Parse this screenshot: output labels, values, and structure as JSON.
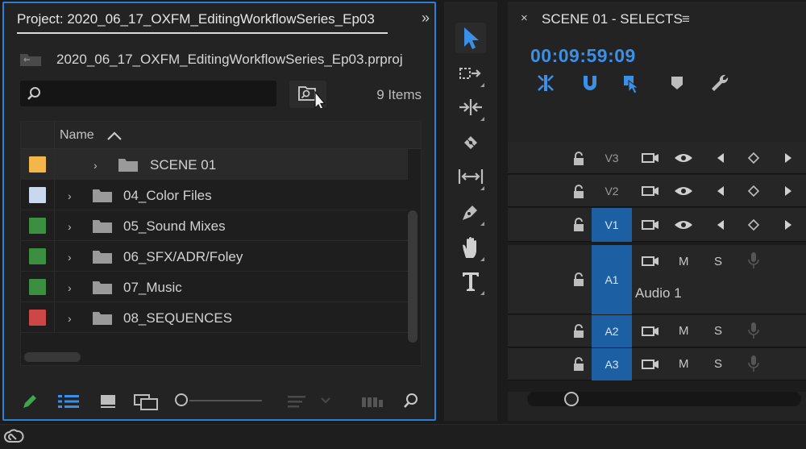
{
  "project_panel": {
    "tab_title": "Project: 2020_06_17_OXFM_EditingWorkflowSeries_Ep03",
    "menu_glyph": "»",
    "project_file": "2020_06_17_OXFM_EditingWorkflowSeries_Ep03.prproj",
    "search": {
      "placeholder": "",
      "value": ""
    },
    "item_count": "9 Items",
    "column_name": "Name",
    "items": [
      {
        "name": "SCENE 01",
        "color": "#f2b64a",
        "nested": true
      },
      {
        "name": "04_Color Files",
        "color": "#c9d8ef",
        "nested": false
      },
      {
        "name": "05_Sound Mixes",
        "color": "#3c8f41",
        "nested": false
      },
      {
        "name": "06_SFX/ADR/Foley",
        "color": "#3c8f41",
        "nested": false
      },
      {
        "name": "07_Music",
        "color": "#3c8f41",
        "nested": false
      },
      {
        "name": "08_SEQUENCES",
        "color": "#cc4745",
        "nested": false
      }
    ]
  },
  "timeline_panel": {
    "close_glyph": "×",
    "sequence_title": "SCENE 01 - SELECTS",
    "menu_glyph": "≡",
    "timecode": "00:09:59:09",
    "accent": "#3b8fe6",
    "video_tracks": [
      "V3",
      "V2",
      "V1"
    ],
    "audio_tracks": [
      "A1",
      "A2",
      "A3"
    ],
    "mute_label": "M",
    "solo_label": "S",
    "audio_track_name": "Audio 1"
  },
  "colors": {
    "panel_focus_border": "#2d7fd6",
    "track_target_blue": "#1d5fa3"
  }
}
